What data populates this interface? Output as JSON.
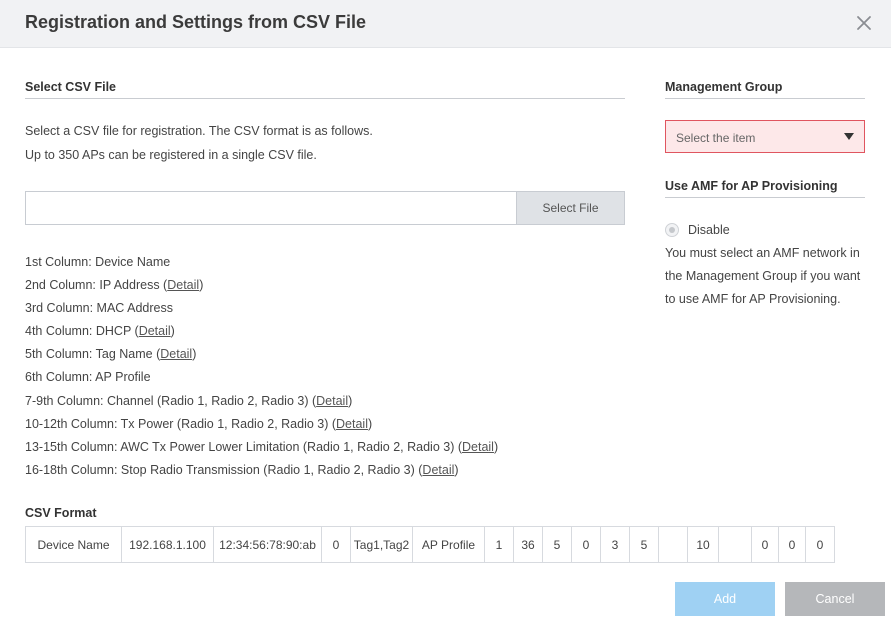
{
  "dialog": {
    "title": "Registration and Settings from CSV File"
  },
  "csv_file": {
    "section_title": "Select CSV File",
    "description_line1": "Select a CSV file for registration. The CSV format is as follows.",
    "description_line2": "Up to 350 APs can be registered in a single CSV file.",
    "file_value": "",
    "select_file_label": "Select File"
  },
  "columns": [
    {
      "text": "1st Column: Device Name",
      "detail": null
    },
    {
      "text": "2nd Column: IP Address (",
      "detail": "Detail"
    },
    {
      "text": "3rd Column: MAC Address",
      "detail": null
    },
    {
      "text": "4th Column: DHCP (",
      "detail": "Detail"
    },
    {
      "text": "5th Column: Tag Name (",
      "detail": "Detail"
    },
    {
      "text": "6th Column: AP Profile",
      "detail": null
    },
    {
      "text": "7-9th Column: Channel (Radio 1, Radio 2, Radio 3) (",
      "detail": "Detail"
    },
    {
      "text": "10-12th Column: Tx Power (Radio 1, Radio 2, Radio 3) (",
      "detail": "Detail"
    },
    {
      "text": "13-15th Column: AWC Tx Power Lower Limitation (Radio 1, Radio 2, Radio 3) (",
      "detail": "Detail"
    },
    {
      "text": "16-18th Column: Stop Radio Transmission (Radio 1, Radio 2, Radio 3) (",
      "detail": "Detail"
    }
  ],
  "csv_format": {
    "title": "CSV Format",
    "cells": [
      "Device Name",
      "192.168.1.100",
      "12:34:56:78:90:ab",
      "0",
      "Tag1,Tag2",
      "AP Profile",
      "1",
      "36",
      "5",
      "0",
      "3",
      "5",
      "",
      "10",
      "",
      "0",
      "0",
      "0"
    ]
  },
  "management_group": {
    "title": "Management Group",
    "placeholder": "Select the item",
    "icon": "caret-down-icon",
    "error_color": "#e0555f"
  },
  "amf": {
    "title": "Use AMF for AP Provisioning",
    "option_label": "Disable",
    "note": "You must select an AMF network in the Management Group if you want to use AMF for AP Provisioning."
  },
  "buttons": {
    "add_label": "Add",
    "cancel_label": "Cancel",
    "add_color": "#9fd1f3",
    "cancel_color": "#b5b7ba"
  }
}
